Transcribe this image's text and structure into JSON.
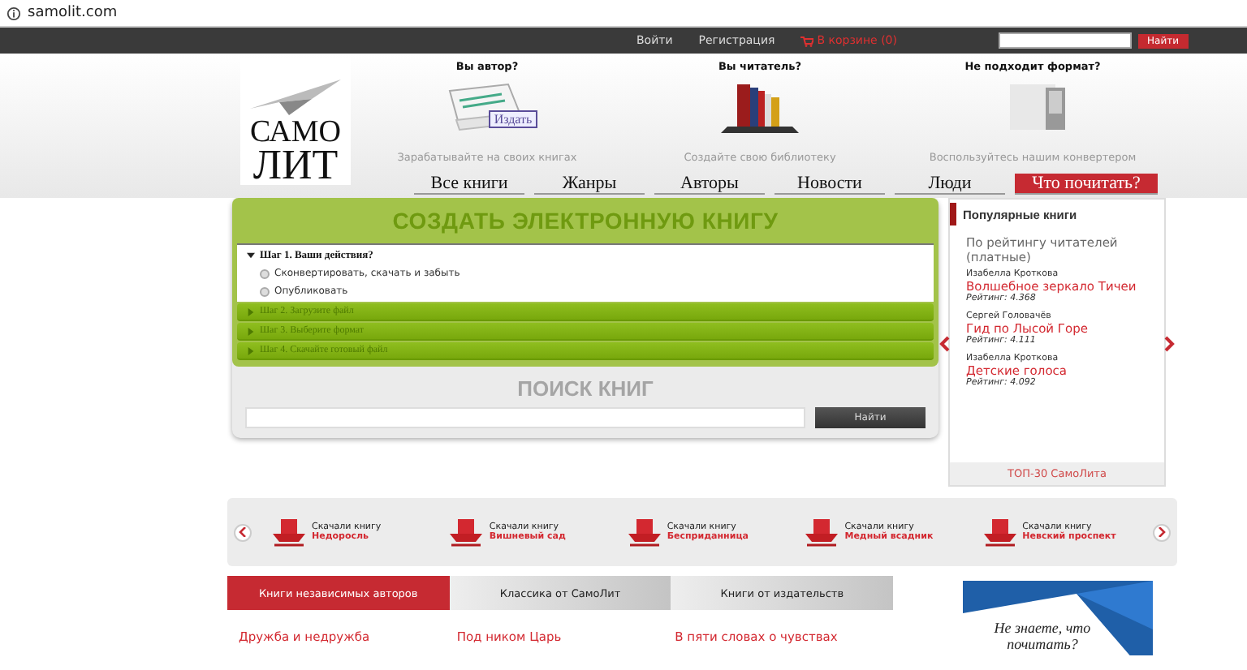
{
  "browser": {
    "url": "samolit.com"
  },
  "topbar": {
    "links": [
      "Войти",
      "Регистрация"
    ],
    "cart": "В корзине (0)",
    "search_button": "Найти"
  },
  "logo": {
    "line1": "САМО",
    "line2": "ЛИТ"
  },
  "promos": [
    {
      "title": "Вы автор?",
      "caption": "Зарабатывайте на своих книгах",
      "stamp": "Издать",
      "kind": "author"
    },
    {
      "title": "Вы читатель?",
      "caption": "Создайте свою библиотеку",
      "kind": "reader"
    },
    {
      "title": "Не подходит формат?",
      "caption": "Воспользуйтесь нашим конвертером",
      "kind": "formats"
    }
  ],
  "nav": [
    {
      "label": "Все книги",
      "selected": false
    },
    {
      "label": "Жанры",
      "selected": false
    },
    {
      "label": "Авторы",
      "selected": false
    },
    {
      "label": "Новости",
      "selected": false
    },
    {
      "label": "Люди",
      "selected": false
    },
    {
      "label": "Что почитать?",
      "selected": true
    }
  ],
  "create": {
    "title": "СОЗДАТЬ ЭЛЕКТРОННУЮ КНИГУ",
    "steps": [
      {
        "label": "Шаг 1. Ваши действия?",
        "expanded": true,
        "options": [
          {
            "label": "Сконвертировать, скачать и забыть",
            "selected": false
          },
          {
            "label": "Опубликовать",
            "selected": false
          }
        ]
      },
      {
        "label": "Шаг 2. Загрузите файл",
        "expanded": false
      },
      {
        "label": "Шаг 3. Выберите формат",
        "expanded": false
      },
      {
        "label": "Шаг 4. Скачайте готовый файл",
        "expanded": false
      }
    ]
  },
  "book_search": {
    "title": "ПОИСК КНИГ",
    "button": "Найти"
  },
  "popular": {
    "title": "Популярные книги",
    "subtitle": "По рейтингу читателей (платные)",
    "books": [
      {
        "author": "Изабелла Кроткова",
        "title": "Волшебное зеркало Тичеи",
        "rating": "Рейтинг: 4.368"
      },
      {
        "author": "Сергей Головачёв",
        "title": "Гид по Лысой Горе",
        "rating": "Рейтинг: 4.111"
      },
      {
        "author": "Изабелла Кроткова",
        "title": "Детские голоса",
        "rating": "Рейтинг: 4.092"
      }
    ],
    "footer": "ТОП-30 СамоЛита"
  },
  "downloads": [
    {
      "label": "Скачали книгу",
      "title": "Недоросль"
    },
    {
      "label": "Скачали книгу",
      "title": "Вишневый сад"
    },
    {
      "label": "Скачали книгу",
      "title": "Бесприданница"
    },
    {
      "label": "Скачали книгу",
      "title": "Медный всадник"
    },
    {
      "label": "Скачали книгу",
      "title": "Невский проспект"
    }
  ],
  "book_tabs": [
    {
      "label": "Книги независимых авторов",
      "selected": true
    },
    {
      "label": "Классика от СамоЛит",
      "selected": false
    },
    {
      "label": "Книги от издательств",
      "selected": false
    }
  ],
  "book_titles": [
    "Дружба и недружба",
    "Под ником Царь",
    "В пяти словах о чувствах"
  ],
  "ad": {
    "text": "Не знаете, что почитать?"
  }
}
